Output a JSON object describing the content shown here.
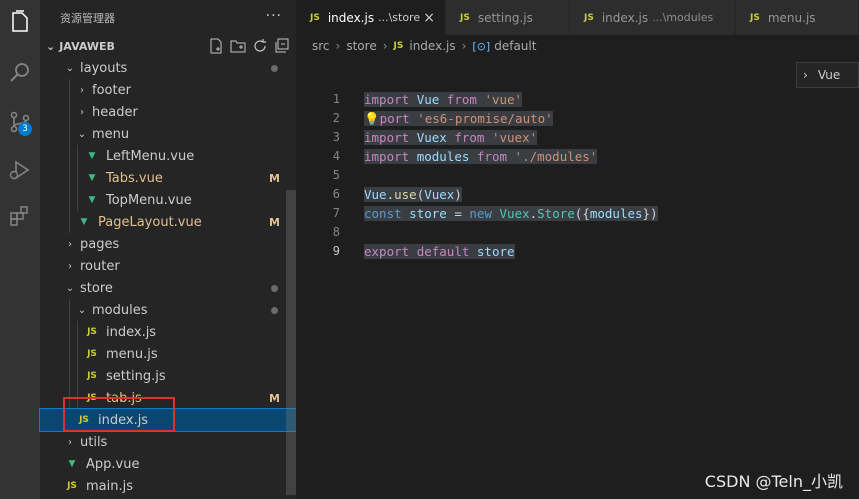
{
  "sidebar": {
    "title": "资源管理器",
    "more_label": "···",
    "section_title": "JAVAWEB",
    "tree": [
      {
        "label": "layouts",
        "type": "folder",
        "open": true,
        "depth": 1,
        "dot": true
      },
      {
        "label": "footer",
        "type": "folder",
        "open": false,
        "depth": 2
      },
      {
        "label": "header",
        "type": "folder",
        "open": false,
        "depth": 2
      },
      {
        "label": "menu",
        "type": "folder",
        "open": true,
        "depth": 2
      },
      {
        "label": "LeftMenu.vue",
        "type": "vue",
        "depth": 3
      },
      {
        "label": "Tabs.vue",
        "type": "vue",
        "depth": 3,
        "status": "M"
      },
      {
        "label": "TopMenu.vue",
        "type": "vue",
        "depth": 3
      },
      {
        "label": "PageLayout.vue",
        "type": "vue",
        "depth": 2,
        "status": "M"
      },
      {
        "label": "pages",
        "type": "folder",
        "open": false,
        "depth": 1
      },
      {
        "label": "router",
        "type": "folder",
        "open": false,
        "depth": 1
      },
      {
        "label": "store",
        "type": "folder",
        "open": true,
        "depth": 1,
        "dot": true
      },
      {
        "label": "modules",
        "type": "folder",
        "open": true,
        "depth": 2,
        "dot": true
      },
      {
        "label": "index.js",
        "type": "js",
        "depth": 3
      },
      {
        "label": "menu.js",
        "type": "js",
        "depth": 3
      },
      {
        "label": "setting.js",
        "type": "js",
        "depth": 3
      },
      {
        "label": "tab.js",
        "type": "js",
        "depth": 3,
        "status": "M"
      },
      {
        "label": "index.js",
        "type": "js",
        "depth": 2,
        "selected": true
      },
      {
        "label": "utils",
        "type": "folder",
        "open": false,
        "depth": 1
      },
      {
        "label": "App.vue",
        "type": "vue",
        "depth": 1
      },
      {
        "label": "main.js",
        "type": "js",
        "depth": 1
      }
    ]
  },
  "activity": {
    "scm_badge": "3"
  },
  "tabs": [
    {
      "label": "index.js",
      "desc": "...\\store",
      "active": true,
      "close": "×"
    },
    {
      "label": "setting.js",
      "desc": ""
    },
    {
      "label": "index.js",
      "desc": "...\\modules"
    },
    {
      "label": "menu.js",
      "desc": ""
    }
  ],
  "breadcrumb": {
    "parts": [
      "src",
      "store",
      "index.js",
      "default"
    ],
    "sep": "›"
  },
  "outline_peek": {
    "chevron": "›",
    "label": "Vue"
  },
  "code": {
    "line_numbers": [
      "1",
      "2",
      "3",
      "4",
      "5",
      "6",
      "7",
      "8",
      "9"
    ],
    "current_line": 9
  },
  "watermark": "CSDN @Teln_小凯",
  "colors": {
    "accent": "#007acc",
    "modified": "#e2c08d",
    "selection_box": "#e03131"
  }
}
